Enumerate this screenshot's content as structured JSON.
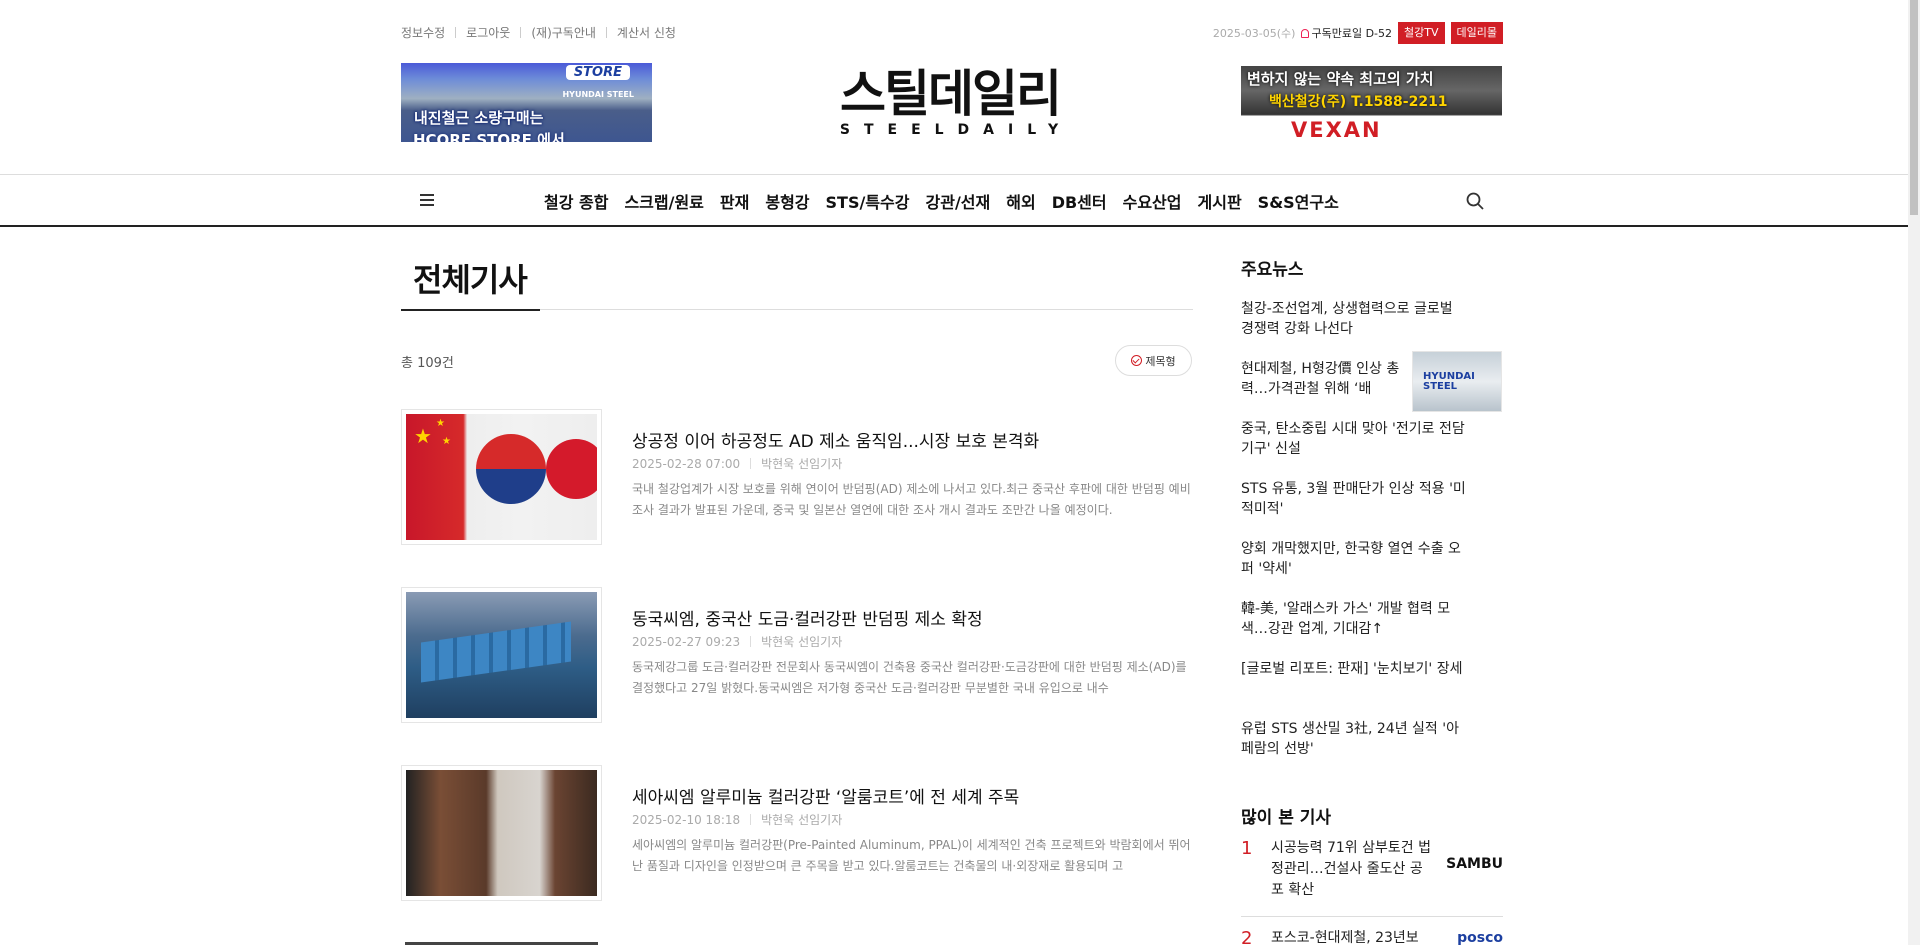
{
  "util": {
    "links": [
      "정보수정",
      "로그아웃",
      "(재)구독안내",
      "계산서 신청"
    ],
    "date": "2025-03-05(수)",
    "subscription": "구독만료일 D-52",
    "btn_tv": "철강TV",
    "btn_mall": "데일리몰"
  },
  "banner_left": {
    "store": "STORE",
    "brand": "HYUNDAI STEEL",
    "line1": "내진철근 소량구매는",
    "line2": "HCORE STORE 에서"
  },
  "logo": {
    "ko_main": "스틸데일리",
    "en": "STEELDAILY"
  },
  "banner_right": {
    "line1": "변하지 않는 약속 최고의 가치",
    "line2": "백산철강(주) T.1588-2211",
    "line3": "VEXAN"
  },
  "nav": {
    "items": [
      "철강 종합",
      "스크랩/원료",
      "판재",
      "봉형강",
      "STS/특수강",
      "강관/선재",
      "해외",
      "DB센터",
      "수요산업",
      "게시판",
      "S&S연구소"
    ]
  },
  "main": {
    "title": "전체기사",
    "count": "총 109건",
    "view_toggle": "제목형",
    "articles": [
      {
        "title": "상공정 이어 하공정도 AD 제소 움직임...시장 보호 본격화",
        "date": "2025-02-28 07:00",
        "author": "박현욱 선임기자",
        "summary": "국내 철강업계가 시장 보호를 위해 연이어 반덤핑(AD) 제소에 나서고 있다.최근 중국산 후판에 대한 반덤핑 예비조사 결과가 발표된 가운데, 중국 및 일본산 열연에 대한 조사 개시 결과도 조만간 나올 예정이다."
      },
      {
        "title": "동국씨엠, 중국산 도금·컬러강판 반덤핑 제소 확정",
        "date": "2025-02-27 09:23",
        "author": "박현욱 선임기자",
        "summary": "동국제강그룹 도금·컬러강판 전문회사 동국씨엠이 건축용 중국산 컬러강판·도금강판에 대한 반덤핑 제소(AD)를 결정했다고 27일 밝혔다.동국씨엠은 저가형 중국산 도금·컬러강판 무분별한 국내 유입으로 내수"
      },
      {
        "title": "세아씨엠 알루미늄 컬러강판 ‘알룸코트’에 전 세계 주목",
        "date": "2025-02-10 18:18",
        "author": "박현욱 선임기자",
        "summary": "세아씨엠의 알루미늄 컬러강판(Pre-Painted Aluminum, PPAL)이 세계적인 건축 프로젝트와 박람회에서 뛰어난 품질과 디자인을 인정받으며 큰 주목을 받고 있다.알룸코트는 건축물의 내·외장재로 활용되며 고"
      }
    ]
  },
  "sidebar": {
    "main_news_title": "주요뉴스",
    "main_news": [
      "철강-조선업계, 상생협력으로 글로벌 경쟁력 강화 나선다",
      "현대제철, H형강價 인상 총력…가격관철 위해 ‘배",
      "중국, 탄소중립 시대 맞아 '전기로 전담기구' 신설",
      "STS 유통, 3월 판매단가 인상 적용 '미적미적'",
      "양회 개막했지만, 한국향 열연 수출 오퍼 '약세'",
      "韓-美, '알래스카 가스' 개발 협력 모색…강관 업계, 기대감↑",
      "[글로벌 리포트: 판재] '눈치보기' 장세",
      "유럽 STS 생산밀 3社, 24년 실적 '아페람의 선방'"
    ],
    "thumb_label": "HYUNDAI STEEL",
    "popular_title": "많이 본 기사",
    "popular": [
      {
        "rank": "1",
        "title": "시공능력 71위 삼부토건 법정관리…건설사 줄도산 공포 확산",
        "logo": "SAMBU"
      },
      {
        "rank": "2",
        "title": "포스코-현대제철, 23년보",
        "logo": "posco"
      }
    ]
  }
}
